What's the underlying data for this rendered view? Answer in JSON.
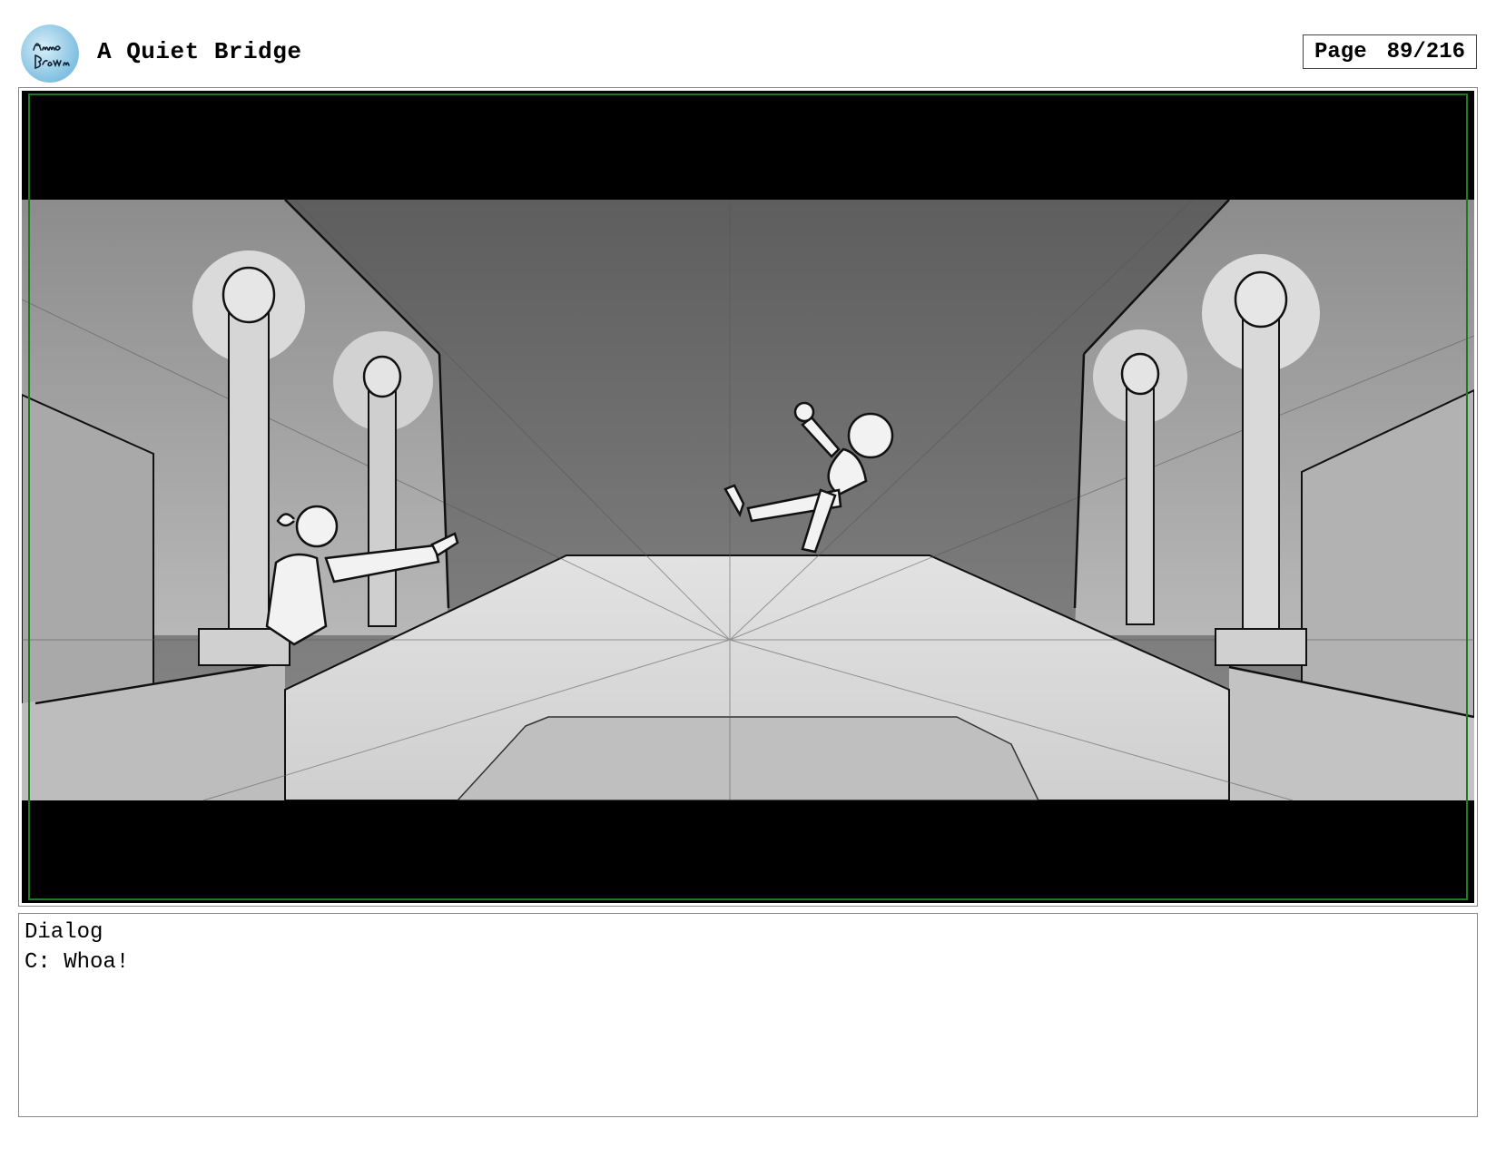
{
  "header": {
    "logo": "Anna Brown",
    "title": "A Quiet Bridge",
    "page_label": "Page",
    "page_number": "89/216"
  },
  "panel": {
    "image": "storyboard-panel-bridge-scene",
    "colors": {
      "letterbox": "#000000",
      "safe_frame": "#1f7a1f",
      "sky": "#6e6e6e",
      "road": "#d6d6d6"
    }
  },
  "dialog": {
    "heading": "Dialog",
    "line": "C: Whoa!"
  }
}
